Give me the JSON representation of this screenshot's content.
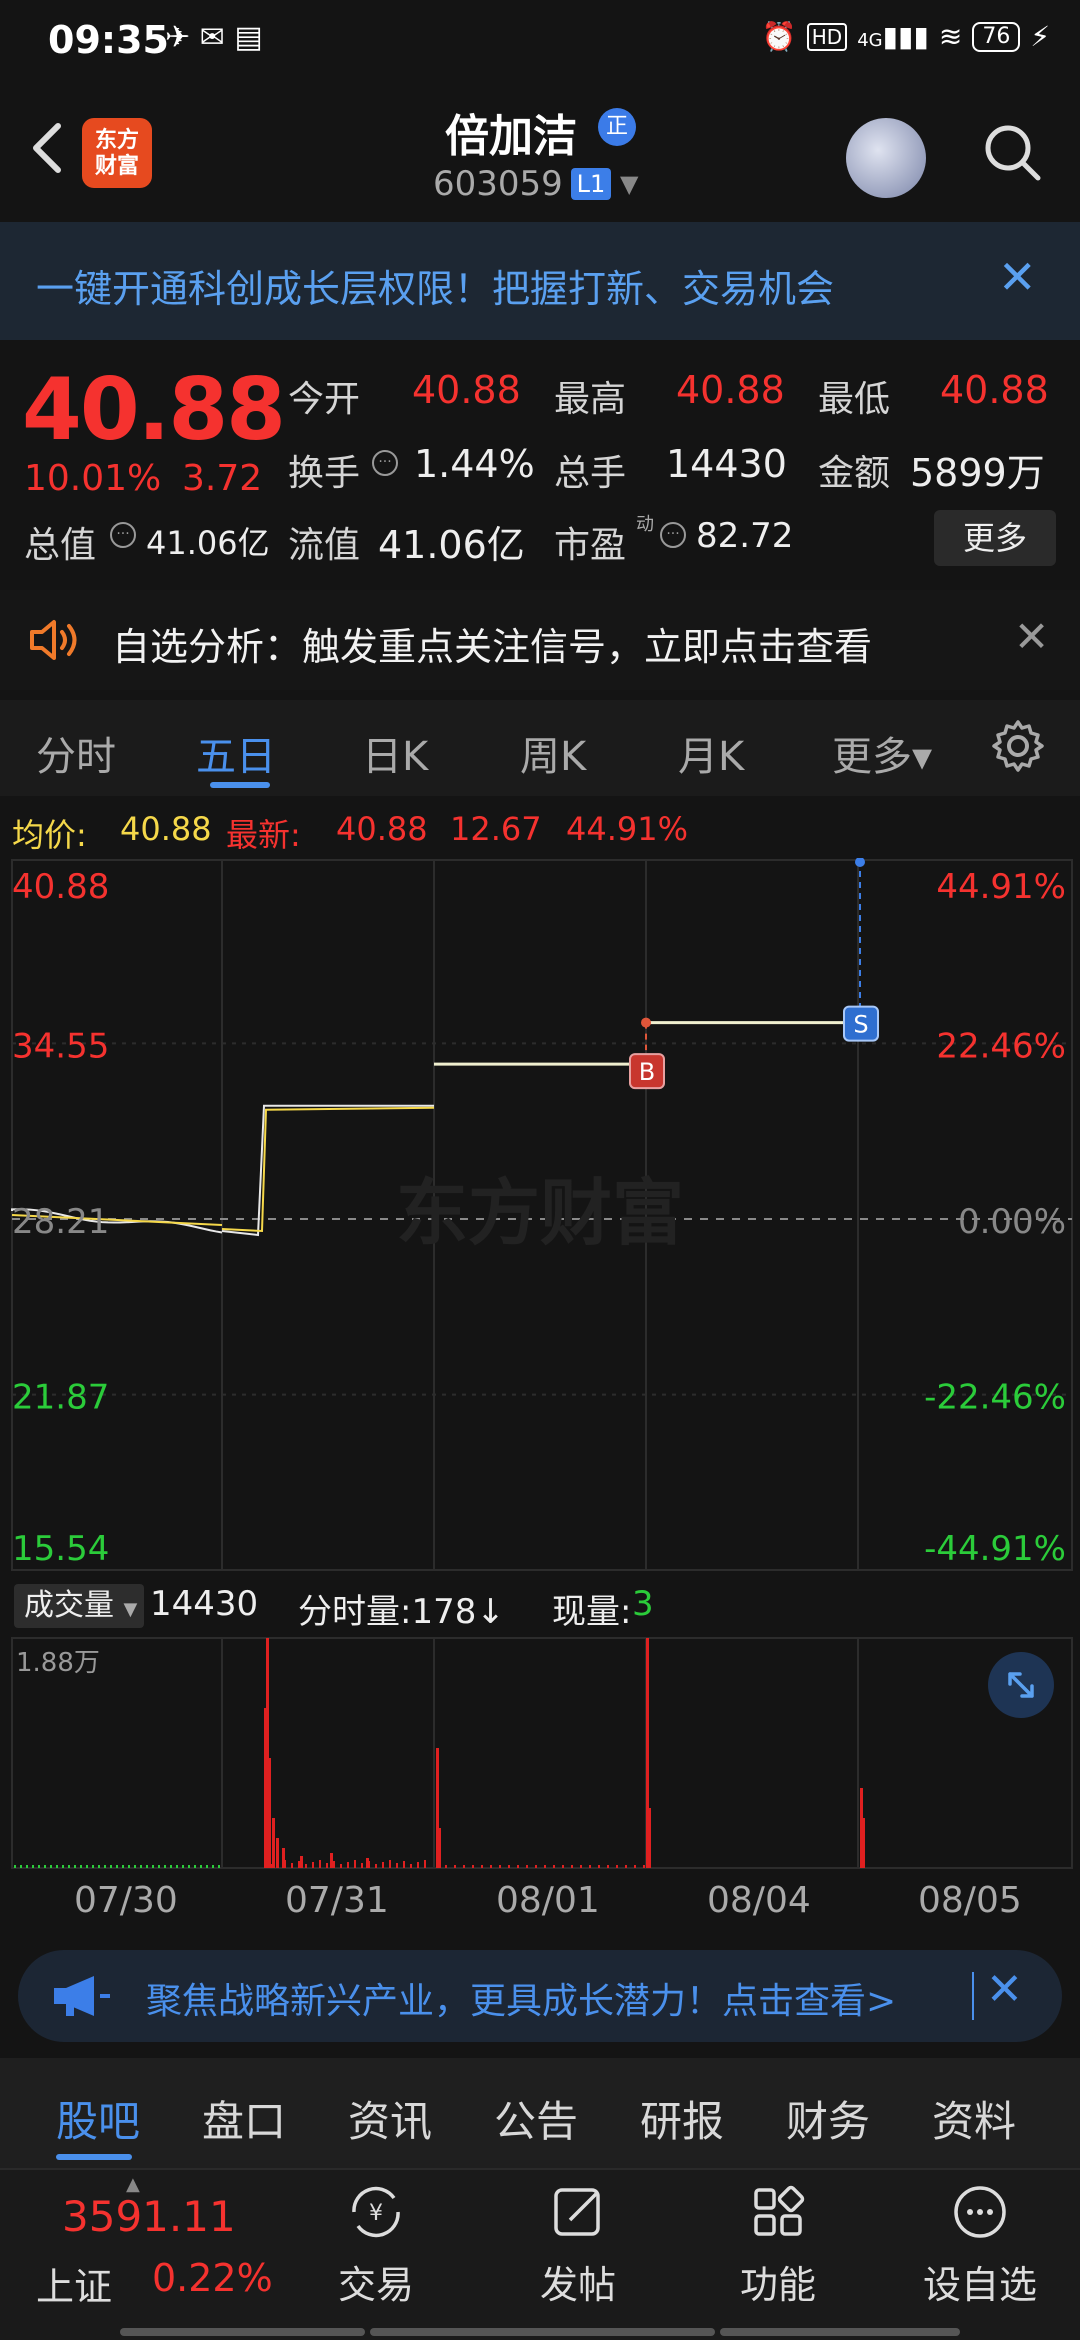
{
  "status_bar": {
    "time": "09:35",
    "battery": "76",
    "network": "4G"
  },
  "header": {
    "app_logo_text": "东方\n财富",
    "stock_name": "倍加洁",
    "name_badge": "正",
    "stock_code": "603059",
    "level_badge": "L1"
  },
  "promo_banner": {
    "text": "一键开通科创成长层权限！把握打新、交易机会"
  },
  "quote": {
    "price": "40.88",
    "change_pct": "10.01%",
    "change_val": "3.72",
    "open_label": "今开",
    "open_val": "40.88",
    "high_label": "最高",
    "high_val": "40.88",
    "low_label": "最低",
    "low_val": "40.88",
    "turnover_label": "换手",
    "turnover_val": "1.44%",
    "volume_label": "总手",
    "volume_val": "14430",
    "amount_label": "金额",
    "amount_val": "5899万",
    "mktcap_label": "总值",
    "mktcap_val": "41.06亿",
    "float_label": "流值",
    "float_val": "41.06亿",
    "pe_label": "市盈",
    "pe_sup": "动",
    "pe_val": "82.72",
    "more_button": "更多"
  },
  "analysis_notice": {
    "text": "自选分析：触发重点关注信号，立即点击查看"
  },
  "chart_tabs": [
    {
      "label": "分时"
    },
    {
      "label": "五日"
    },
    {
      "label": "日K"
    },
    {
      "label": "周K"
    },
    {
      "label": "月K"
    },
    {
      "label": "更多▾"
    }
  ],
  "legend": {
    "avg_label": "均价:",
    "avg_val": "40.88",
    "latest_label": "最新:",
    "latest_val": "40.88",
    "latest_chg": "12.67",
    "latest_pct": "44.91%"
  },
  "chart_data": {
    "type": "line",
    "title": "",
    "x": [
      "07/30",
      "07/31",
      "08/01",
      "08/04",
      "08/05"
    ],
    "series": [
      {
        "values": [
          28.21,
          32.3,
          33.8,
          35.3,
          40.88
        ]
      }
    ],
    "y_left_ticks": [
      "40.88",
      "34.55",
      "28.21",
      "21.87",
      "15.54"
    ],
    "y_right_ticks": [
      "44.91%",
      "22.46%",
      "0.00%",
      "-22.46%",
      "-44.91%"
    ],
    "ylim": [
      15.54,
      40.88
    ],
    "markers": [
      {
        "label": "B",
        "date": "08/04"
      },
      {
        "label": "S",
        "date": "08/05"
      }
    ],
    "watermark": "东方财富",
    "volume": {
      "label": "成交量",
      "total": "14430",
      "tick_label": "分时量:178↓",
      "current_label": "现量:",
      "current_val": "3",
      "max_label": "1.88万"
    }
  },
  "dates": [
    "07/30",
    "07/31",
    "08/01",
    "08/04",
    "08/05"
  ],
  "focus_banner": {
    "text": "聚焦战略新兴产业，更具成长潜力！点击查看>"
  },
  "bottom_tabs": [
    {
      "label": "股吧"
    },
    {
      "label": "盘口"
    },
    {
      "label": "资讯"
    },
    {
      "label": "公告"
    },
    {
      "label": "研报"
    },
    {
      "label": "财务"
    },
    {
      "label": "资料"
    }
  ],
  "bottom_nav": {
    "index_value": "3591.11",
    "index_name": "上证",
    "index_pct": "0.22%",
    "items": [
      {
        "label": "交易"
      },
      {
        "label": "发帖"
      },
      {
        "label": "功能"
      },
      {
        "label": "设自选"
      }
    ]
  },
  "colors": {
    "up": "#f5322f",
    "down": "#2bcc3a",
    "accent": "#4a90ec",
    "avg_line": "#f5d84a"
  }
}
